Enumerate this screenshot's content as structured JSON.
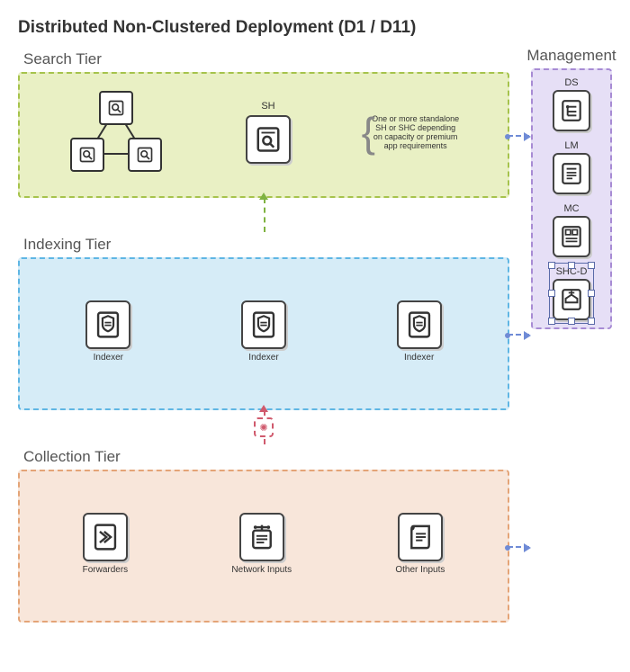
{
  "title": "Distributed Non-Clustered Deployment (D1 / D11)",
  "tiers": {
    "search": {
      "label": "Search Tier",
      "sh_label": "SH",
      "note": "One or more standalone SH or SHC depending on capacity or premium app requirements"
    },
    "indexing": {
      "label": "Indexing Tier",
      "items": [
        {
          "label": "Indexer"
        },
        {
          "label": "Indexer"
        },
        {
          "label": "Indexer"
        }
      ]
    },
    "collection": {
      "label": "Collection Tier",
      "items": [
        {
          "label": "Forwarders"
        },
        {
          "label": "Network Inputs"
        },
        {
          "label": "Other Inputs"
        }
      ]
    }
  },
  "management": {
    "label": "Management",
    "items": [
      {
        "code": "DS"
      },
      {
        "code": "LM"
      },
      {
        "code": "MC"
      },
      {
        "code": "SHC-D",
        "selected": true
      }
    ]
  },
  "colors": {
    "search": "#e9f0c4",
    "indexing": "#d6ecf7",
    "collection": "#f8e6da",
    "management": "#e6dff6"
  }
}
